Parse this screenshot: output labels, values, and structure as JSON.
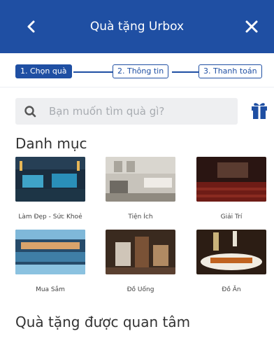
{
  "header": {
    "title": "Quà tặng Urbox"
  },
  "steps": [
    "1. Chọn quà",
    "2. Thông tin",
    "3. Thanh toán"
  ],
  "search": {
    "placeholder": "Bạn muốn tìm quà gì?"
  },
  "sections": {
    "categories": "Danh mục",
    "interested": "Quà tặng được quan tâm"
  },
  "categories": [
    {
      "label": "Làm Đẹp - Sức Khoẻ"
    },
    {
      "label": "Tiện Ích"
    },
    {
      "label": "Giải Trí"
    },
    {
      "label": "Mua Sắm"
    },
    {
      "label": "Đồ Uống"
    },
    {
      "label": "Đồ Ăn"
    }
  ],
  "colors": {
    "primary": "#1f4fa3",
    "search_bg": "#eeeff1"
  },
  "icons": [
    "back-icon",
    "close-icon",
    "search-icon",
    "gift-icon"
  ]
}
